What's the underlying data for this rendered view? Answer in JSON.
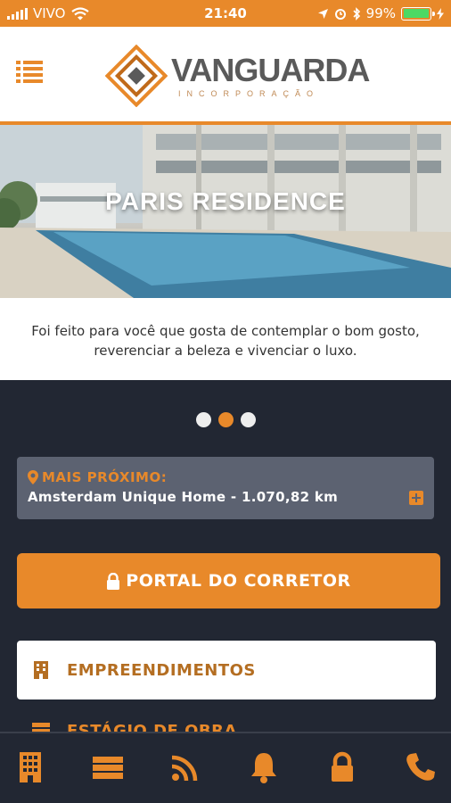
{
  "status_bar": {
    "carrier": "VIVO",
    "time": "21:40",
    "battery": "99%",
    "battery_level": 0.99
  },
  "header": {
    "brand_name": "VANGUARDA",
    "brand_subtitle": "INCORPORAÇÃO"
  },
  "hero": {
    "title": "PARIS RESIDENCE",
    "caption_line1": "Foi feito para você que gosta de contemplar o bom gosto,",
    "caption_line2": "reverenciar a beleza e vivenciar o luxo."
  },
  "carousel": {
    "pages": 3,
    "active_index": 1
  },
  "nearest": {
    "label": "MAIS PRÓXIMO:",
    "value": "Amsterdam Unique Home - 1.070,82 km"
  },
  "portal_button": {
    "label": "PORTAL DO CORRETOR"
  },
  "menu": {
    "items": [
      {
        "label": "EMPREENDIMENTOS",
        "icon": "building-icon"
      },
      {
        "label": "ESTÁGIO DE OBRA",
        "icon": "server-icon"
      }
    ]
  },
  "tabbar": {
    "tabs": [
      {
        "icon": "building-icon"
      },
      {
        "icon": "server-icon"
      },
      {
        "icon": "rss-icon"
      },
      {
        "icon": "bell-icon"
      },
      {
        "icon": "lock-icon"
      },
      {
        "icon": "phone-icon"
      }
    ]
  },
  "colors": {
    "accent": "#e8892a",
    "background": "#222733",
    "card": "#5c6271",
    "menu_text": "#b46e22"
  }
}
